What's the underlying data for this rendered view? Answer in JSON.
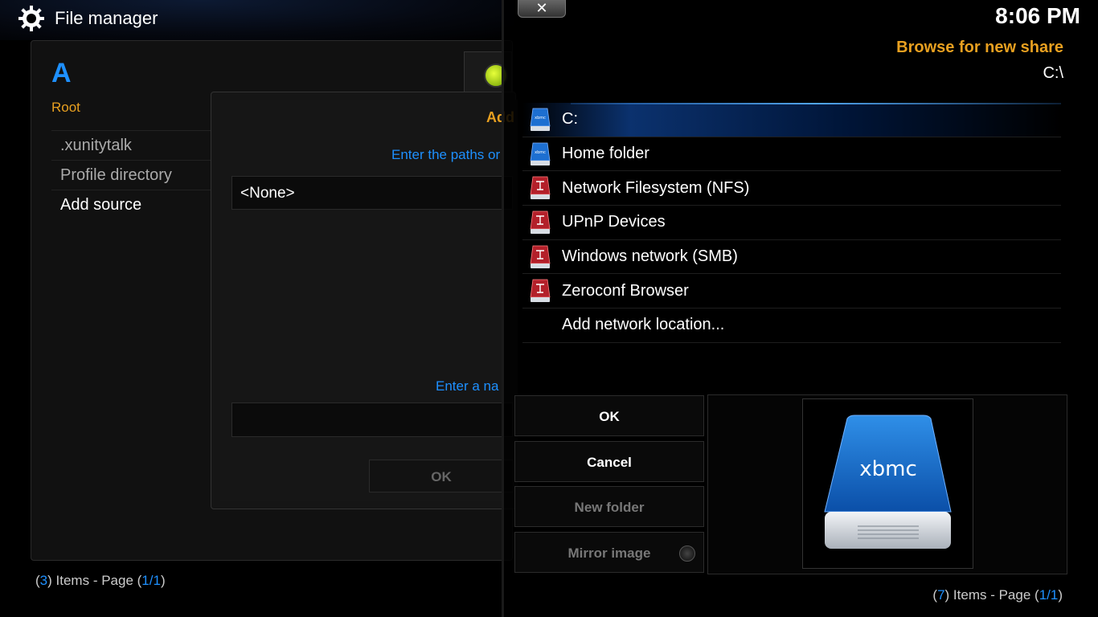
{
  "header": {
    "title": "File manager",
    "icon": "gear-icon"
  },
  "left_pane": {
    "letter": "A",
    "root_label": "Root",
    "items": [
      ".xunitytalk",
      "Profile directory",
      "Add source"
    ],
    "footer": {
      "count": "3",
      "page": "1/1",
      "text_items": "Items - Page"
    }
  },
  "add_source_dialog": {
    "title": "Add",
    "enter_paths": "Enter the paths or",
    "path_value": "<None>",
    "enter_name": "Enter a na",
    "ok_label": "OK"
  },
  "browse_dialog": {
    "clock": "8:06 PM",
    "title": "Browse for new share",
    "path": "C:\\",
    "shares": [
      {
        "label": "C:",
        "icon": "drive-icon",
        "focused": true
      },
      {
        "label": "Home folder",
        "icon": "drive-icon"
      },
      {
        "label": "Network Filesystem (NFS)",
        "icon": "network-drive-icon"
      },
      {
        "label": "UPnP Devices",
        "icon": "network-drive-icon"
      },
      {
        "label": "Windows network (SMB)",
        "icon": "network-drive-icon"
      },
      {
        "label": "Zeroconf Browser",
        "icon": "network-drive-icon"
      },
      {
        "label": "Add network location...",
        "icon": ""
      }
    ],
    "buttons": {
      "ok": "OK",
      "cancel": "Cancel",
      "new_folder": "New folder",
      "mirror_image": "Mirror image"
    },
    "preview_icon": "xbmc-drive-icon",
    "preview_brand": "xbmc",
    "footer": {
      "count": "7",
      "page": "1/1",
      "text_items": "Items - Page"
    }
  },
  "colors": {
    "accent": "#1e90ff",
    "title_orange": "#e8a020",
    "drive_red": "#b3202a"
  }
}
